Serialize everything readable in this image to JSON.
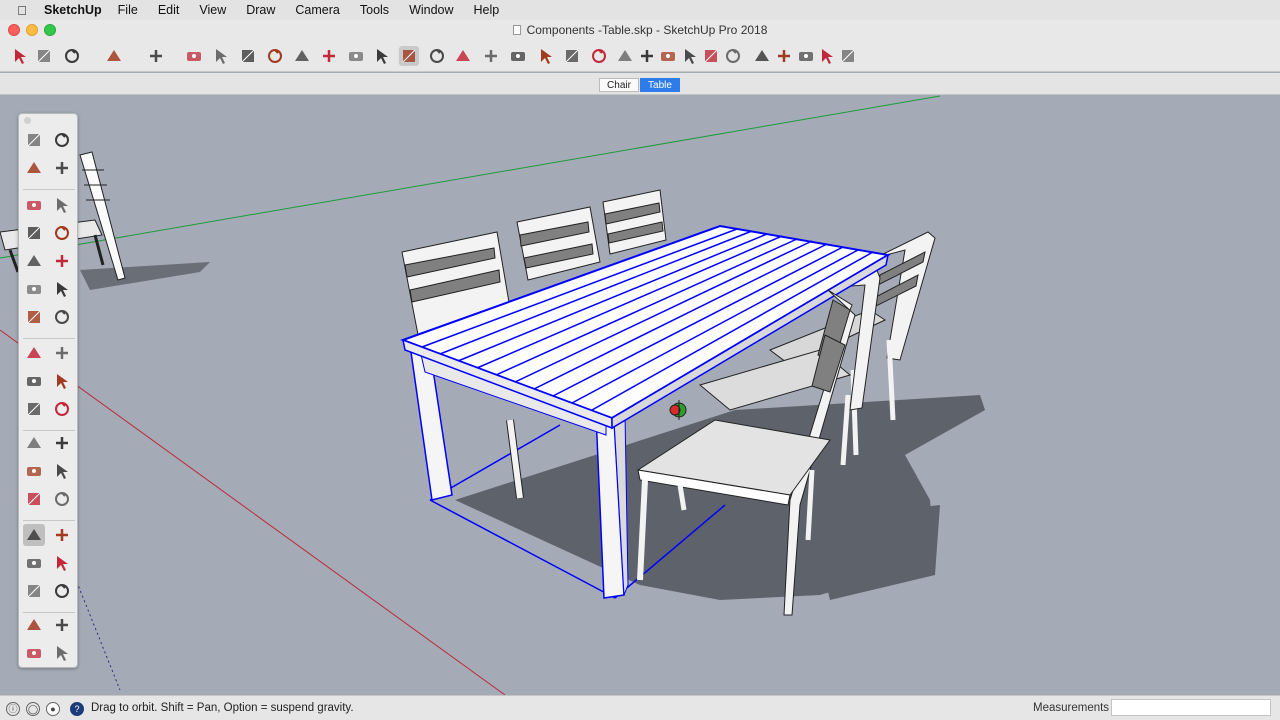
{
  "menubar": {
    "app_name": "SketchUp",
    "items": [
      "File",
      "Edit",
      "View",
      "Draw",
      "Camera",
      "Tools",
      "Window",
      "Help"
    ]
  },
  "window": {
    "title": "Components -Table.skp - SketchUp Pro 2018"
  },
  "scene_tabs": [
    {
      "label": "Chair",
      "active": false
    },
    {
      "label": "Table",
      "active": true
    }
  ],
  "toolbar": {
    "tools": [
      "select",
      "eraser",
      "line",
      "arc",
      "rectangle",
      "push-pull",
      "follow-me",
      "move",
      "rotate",
      "scale",
      "tape-measure",
      "text",
      "paint-bucket",
      "orbit",
      "pan",
      "zoom",
      "zoom-extents",
      "previous-view",
      "next-view",
      "warehouse",
      "iso-view",
      "top-view",
      "front-view",
      "right-view",
      "back-view",
      "left-view",
      "xray-style",
      "wireframe-style",
      "hidden-line-style",
      "shaded-style",
      "textured-style",
      "monochrome-style"
    ],
    "active_tool": "orbit"
  },
  "palette": {
    "tools": [
      "select",
      "make-component",
      "paint-bucket",
      "eraser",
      "line",
      "freehand",
      "rectangle",
      "rotated-rectangle",
      "circle",
      "polygon",
      "arc",
      "two-point-arc",
      "three-point-arc",
      "pie",
      "move",
      "push-pull",
      "rotate",
      "follow-me",
      "scale",
      "offset",
      "tape-measure",
      "dimension",
      "protractor",
      "text",
      "axes",
      "3d-text",
      "orbit",
      "pan",
      "zoom",
      "zoom-window",
      "zoom-extents",
      "previous-view",
      "position-camera",
      "walk",
      "look-around",
      "section-plane"
    ],
    "active_tool": "orbit"
  },
  "status": {
    "hint": "Drag to orbit. Shift = Pan, Option = suspend gravity.",
    "measurements_label": "Measurements",
    "measurements_value": ""
  },
  "colors": {
    "viewport_bg": "#a4abb6",
    "selection_blue": "#0000ff",
    "axis_red": "#c0283a",
    "axis_green": "#1e9a3a",
    "tab_active": "#2e7bea"
  }
}
